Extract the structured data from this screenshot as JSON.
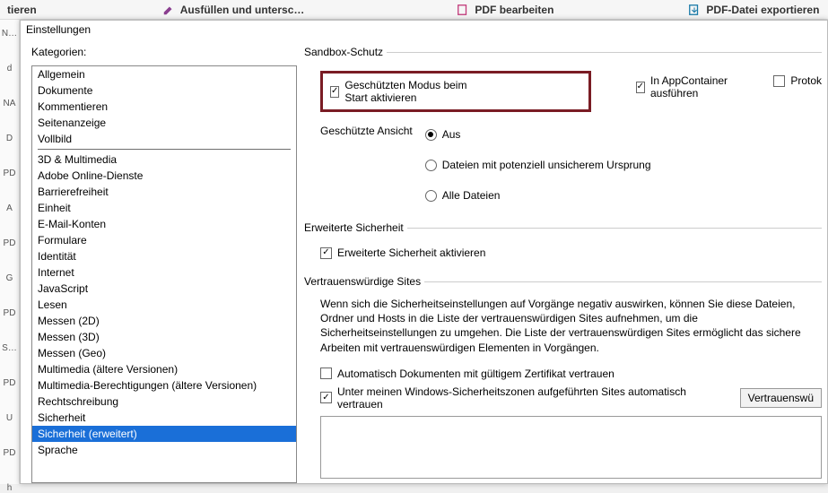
{
  "toolbar": {
    "item0": "tieren",
    "item1": "Ausfüllen und untersc…",
    "item2": "PDF bearbeiten",
    "item3": "PDF-Datei exportieren"
  },
  "leftStrip": {
    "s0": "N…",
    "s1": "d",
    "s2": "NA",
    "s3": "D",
    "s4": "PD",
    "s5": "A",
    "s6": "PD",
    "s7": "G",
    "s8": "PD",
    "s9": "S…",
    "s10": "PD",
    "s11": "U",
    "s12": "PD",
    "s13": "h"
  },
  "dialog": {
    "title": "Einstellungen"
  },
  "categories": {
    "label": "Kategorien:",
    "items": [
      "Allgemein",
      "Dokumente",
      "Kommentieren",
      "Seitenanzeige",
      "Vollbild",
      "__SEP__",
      "3D & Multimedia",
      "Adobe Online-Dienste",
      "Barrierefreiheit",
      "Einheit",
      "E-Mail-Konten",
      "Formulare",
      "Identität",
      "Internet",
      "JavaScript",
      "Lesen",
      "Messen (2D)",
      "Messen (3D)",
      "Messen (Geo)",
      "Multimedia (ältere Versionen)",
      "Multimedia-Berechtigungen (ältere Versionen)",
      "Rechtschreibung",
      "Sicherheit",
      "Sicherheit (erweitert)",
      "Sprache"
    ],
    "selected": "Sicherheit (erweitert)"
  },
  "sandbox": {
    "legend": "Sandbox-Schutz",
    "enableProtected": "Geschützten Modus beim Start aktivieren",
    "appContainer": "In AppContainer ausführen",
    "protok": "Protok",
    "protectedViewLabel": "Geschützte Ansicht",
    "radio": {
      "off": "Aus",
      "potential": "Dateien mit potenziell unsicherem Ursprung",
      "all": "Alle Dateien"
    }
  },
  "enhanced": {
    "legend": "Erweiterte Sicherheit",
    "enable": "Erweiterte Sicherheit aktivieren"
  },
  "trusted": {
    "legend": "Vertrauenswürdige Sites",
    "paragraph": "Wenn sich die Sicherheitseinstellungen auf Vorgänge negativ auswirken,  können Sie diese Dateien, Ordner und Hosts in die Liste der vertrauenswürdigen Sites aufnehmen, um die Sicherheitseinstellungen zu umgehen. Die Liste der vertrauenswürdigen Sites ermöglicht das sichere Arbeiten mit vertrauenswürdigen Elementen in Vorgängen.",
    "autoTrustCert": "Automatisch Dokumenten mit gültigem Zertifikat vertrauen",
    "autoTrustWin": "Unter meinen Windows-Sicherheitszonen aufgeführten Sites automatisch vertrauen",
    "btnTrust": "Vertrauenswü"
  }
}
